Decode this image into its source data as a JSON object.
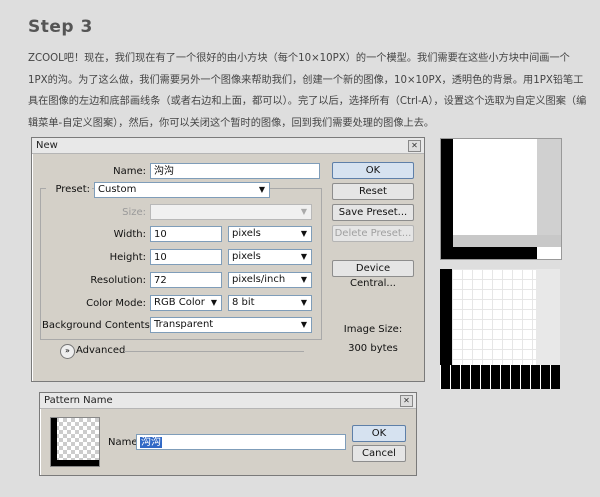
{
  "tutorial": {
    "step_title": "Step 3",
    "paragraph": "ZCOOL吧！现在，我们现在有了一个很好的由小方块（每个10×10PX）的一个模型。我们需要在这些小方块中间画一个1PX的沟。为了这么做，我们需要另外一个图像来帮助我们，创建一个新的图像，10×10PX，透明色的背景。用1PX铅笔工具在图像的左边和底部画线条（或者右边和上面，都可以）。完了以后，选择所有（Ctrl-A），设置这个选取为自定义图案（编辑菜单-自定义图案），然后，你可以关闭这个暂时的图像，回到我们需要处理的图像上去。"
  },
  "new_dialog": {
    "title": "New",
    "name_label": "Name:",
    "name_value": "沟沟",
    "preset_label": "Preset:",
    "preset_value": "Custom",
    "size_label": "Size:",
    "size_value": "",
    "width_label": "Width:",
    "width_value": "10",
    "width_unit": "pixels",
    "height_label": "Height:",
    "height_value": "10",
    "height_unit": "pixels",
    "resolution_label": "Resolution:",
    "resolution_value": "72",
    "resolution_unit": "pixels/inch",
    "color_mode_label": "Color Mode:",
    "color_mode_value": "RGB Color",
    "bit_depth_value": "8 bit",
    "bg_contents_label": "Background Contents:",
    "bg_contents_value": "Transparent",
    "advanced_label": "Advanced",
    "ok_label": "OK",
    "reset_label": "Reset",
    "save_preset_label": "Save Preset...",
    "delete_preset_label": "Delete Preset...",
    "device_central_label": "Device Central...",
    "image_size_label": "Image Size:",
    "image_size_value": "300 bytes"
  },
  "pattern_dialog": {
    "title": "Pattern Name",
    "name_label": "Name:",
    "name_value": "沟沟",
    "ok_label": "OK",
    "cancel_label": "Cancel"
  }
}
